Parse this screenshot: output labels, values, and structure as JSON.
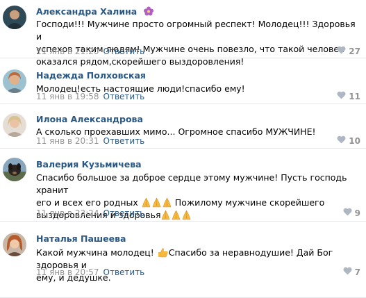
{
  "comments": [
    {
      "author": "Александра Халина",
      "lines": [
        "Господи!!! Мужчине просто огромный респект! Молодец!!! Здоровья и",
        "успехов таким людям! Мужчине очень повезло, что такой человек",
        "оказался рядом,скорейшего выздоровления!"
      ],
      "date": "11 янв в 21:20",
      "reply": "Ответить",
      "likes": "27",
      "avatar_icon": "avatar-portrait-icon",
      "badge_icon": "flower-icon"
    },
    {
      "author": "Надежда Полховская",
      "lines": [
        "Молодец!есть настоящие люди!спасибо ему!"
      ],
      "date": "11 янв в 19:58",
      "reply": "Ответить",
      "likes": "11",
      "avatar_icon": "avatar-portrait-icon"
    },
    {
      "author": "Илона Александрова",
      "lines": [
        "А сколько проехавших мимо... Огромное спасибо МУЖЧИНЕ!"
      ],
      "date": "11 янв в 20:31",
      "reply": "Ответить",
      "likes": "10",
      "avatar_icon": "avatar-portrait-icon"
    },
    {
      "author": "Валерия Кузьмичева",
      "lines": [
        "Спасибо большое за доброе сердце этому мужчине! Пусть господь хранит",
        "его и всех его родных",
        "Пожилому мужчине скорейшего",
        "выздоровления и здоровья"
      ],
      "date": "11 янв в 23:24",
      "reply": "Ответить",
      "likes": "9",
      "avatar_icon": "avatar-dog-icon",
      "emoji_icon": "praying-hands-icon"
    },
    {
      "author": "Наталья Пашеева",
      "lines": [
        "Какой мужчина молодец!",
        "Спасибо за неравнодушие! Дай Бог здоровья и",
        "ему, и дедушке."
      ],
      "date": "11 янв в 20:57",
      "reply": "Ответить",
      "likes": "7",
      "avatar_icon": "avatar-portrait-icon",
      "emoji_icon": "thumbs-up-icon"
    }
  ],
  "like_icon": "heart-icon",
  "colors": {
    "link": "#2a5885",
    "meta": "#939393",
    "divider": "#e7e8ec"
  }
}
